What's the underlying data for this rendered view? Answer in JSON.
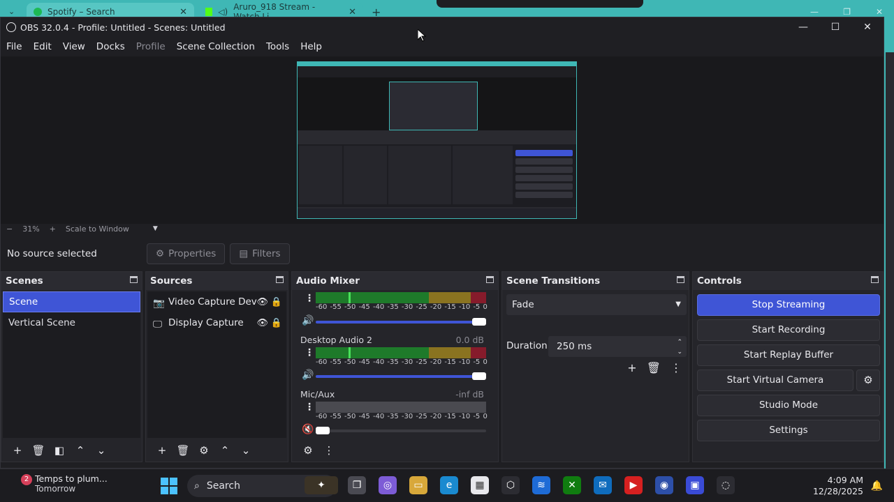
{
  "browser": {
    "tabs": [
      {
        "title": "Spotify – Search"
      },
      {
        "title": "Aruro_918 Stream - Watch Li..."
      }
    ]
  },
  "window": {
    "title": "OBS 32.0.4 - Profile: Untitled - Scenes: Untitled",
    "controls": [
      "—",
      "☐",
      "✕"
    ]
  },
  "menu": {
    "items": [
      "File",
      "Edit",
      "View",
      "Docks",
      "Profile",
      "Scene Collection",
      "Tools",
      "Help"
    ]
  },
  "preview": {
    "zoom": "31%",
    "zoom_minus": "−",
    "zoom_plus": "+",
    "scale_mode": "Scale to Window"
  },
  "sourcebar": {
    "no_source": "No source selected",
    "properties": "Properties",
    "filters": "Filters"
  },
  "scenes": {
    "title": "Scenes",
    "items": [
      {
        "label": "Scene",
        "selected": true
      },
      {
        "label": "Vertical Scene",
        "selected": false
      }
    ]
  },
  "sources": {
    "title": "Sources",
    "items": [
      {
        "label": "Video Capture Dev",
        "icon": "camera-icon"
      },
      {
        "label": "Display Capture",
        "icon": "monitor-icon"
      }
    ]
  },
  "audio_mixer": {
    "title": "Audio Mixer",
    "tick_labels": [
      "-60",
      "-55",
      "-50",
      "-45",
      "-40",
      "-35",
      "-30",
      "-25",
      "-20",
      "-15",
      "-10",
      "-5",
      "0"
    ],
    "channels": [
      {
        "name": "",
        "db": "",
        "muted": false,
        "volume": 1.0
      },
      {
        "name": "Desktop Audio 2",
        "db": "0.0 dB",
        "muted": false,
        "volume": 1.0
      },
      {
        "name": "Mic/Aux",
        "db": "-inf dB",
        "muted": true,
        "volume": 0.0
      }
    ]
  },
  "scene_transitions": {
    "title": "Scene Transitions",
    "type": "Fade",
    "duration_label": "Duration",
    "duration_value": "250 ms"
  },
  "controls": {
    "title": "Controls",
    "buttons": {
      "stop_streaming": "Stop Streaming",
      "start_recording": "Start Recording",
      "start_replay": "Start Replay Buffer",
      "start_virtual_camera": "Start Virtual Camera",
      "studio_mode": "Studio Mode",
      "settings": "Settings"
    }
  },
  "taskbar": {
    "weather_badge": "2",
    "weather_title": "Temps to plum...",
    "weather_sub": "Tomorrow",
    "search_placeholder": "Search",
    "time": "4:09 AM",
    "date": "12/28/2025"
  },
  "colors": {
    "accent_blue": "#3f55d6",
    "browser_teal": "#3fb7b5",
    "panel_bg": "#25252a"
  }
}
